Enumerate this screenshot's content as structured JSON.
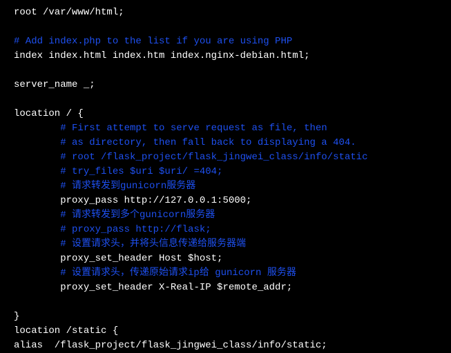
{
  "lines": {
    "l1": "root /var/www/html;",
    "l2": "",
    "l3": "# Add index.php to the list if you are using PHP",
    "l4": "index index.html index.htm index.nginx-debian.html;",
    "l5": "",
    "l6": "server_name _;",
    "l7": "",
    "l8": "location / {",
    "l9": "        # First attempt to serve request as file, then",
    "l10": "        # as directory, then fall back to displaying a 404.",
    "l11": "        # root /flask_project/flask_jingwei_class/info/static",
    "l12": "        # try_files $uri $uri/ =404;",
    "l13": "        # 请求转发到gunicorn服务器",
    "l14": "        proxy_pass http://127.0.0.1:5000;",
    "l15": "        # 请求转发到多个gunicorn服务器",
    "l16": "        # proxy_pass http://flask;",
    "l17": "        # 设置请求头，并将头信息传递给服务器端",
    "l18": "        proxy_set_header Host $host;",
    "l19": "        # 设置请求头，传递原始请求ip给 gunicorn 服务器",
    "l20": "        proxy_set_header X-Real-IP $remote_addr;",
    "l21": "",
    "l22": "}",
    "l23": "location /static {",
    "l24": "alias  /flask_project/flask_jingwei_class/info/static;"
  }
}
